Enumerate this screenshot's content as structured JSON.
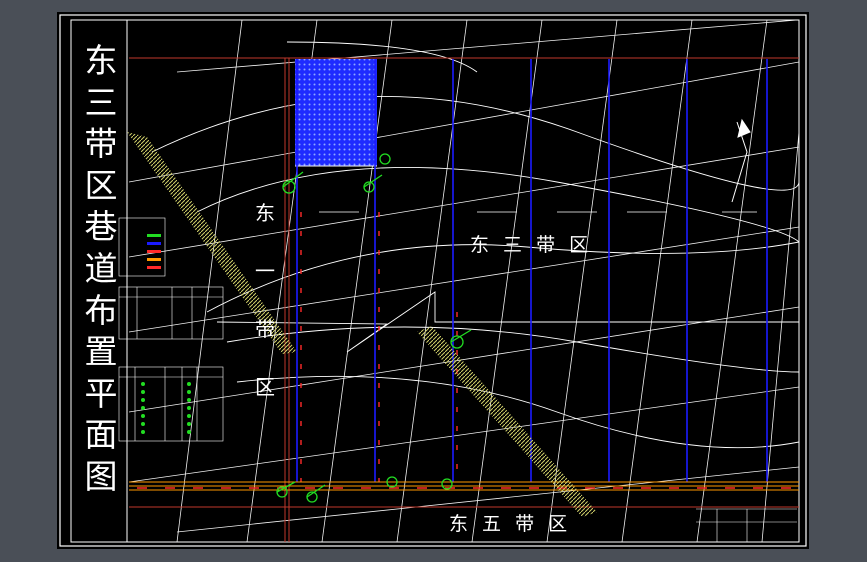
{
  "title_chars": [
    "东",
    "三",
    "带",
    "区",
    "巷",
    "道",
    "布",
    "置",
    "平",
    "面",
    "图"
  ],
  "zones": {
    "east_one": [
      "东",
      "一",
      "带",
      "区"
    ],
    "east_three": "东 三 带 区",
    "east_five": "东 五 带 区"
  },
  "colors": {
    "background_app": "#4a4f57",
    "paper": "#000000",
    "border": "#ffffff",
    "grid": "#ffffff",
    "roadway_blue": "#1b1bff",
    "roadway_red": "#ff2a2a",
    "hatch_blue": "#1f2bff",
    "rail_orange": "#ff9900",
    "symbol_green": "#22dd22",
    "boundary_red": "#c0392b",
    "fault_yellow": "#cfcf6a"
  },
  "icons": {
    "north_arrow": "north-arrow-icon",
    "fan": "fan-symbol-icon"
  }
}
